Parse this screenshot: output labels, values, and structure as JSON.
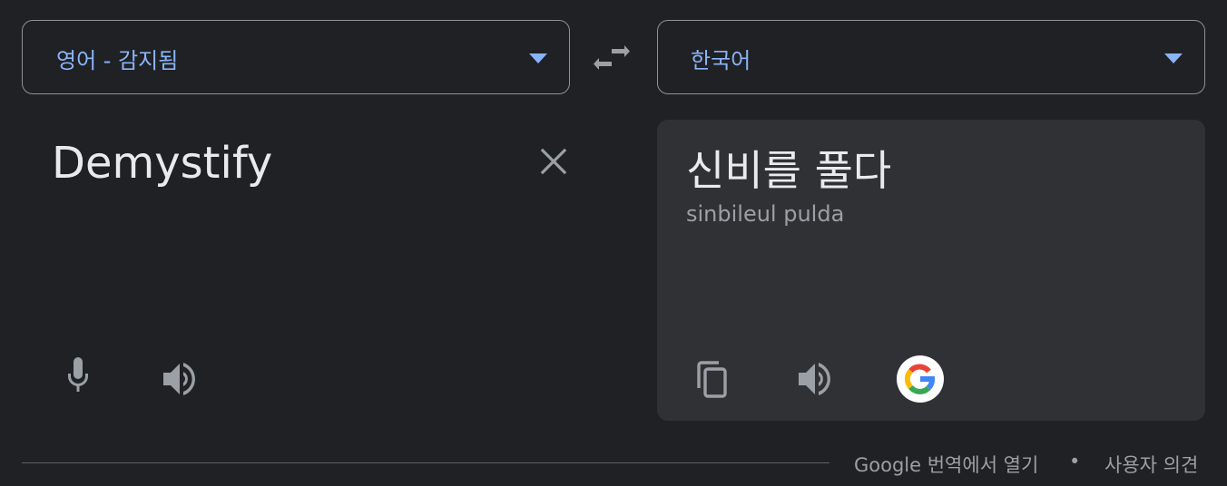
{
  "source_lang": {
    "label": "영어 - 감지됨",
    "icon": "dropdown-caret-icon"
  },
  "target_lang": {
    "label": "한국어",
    "icon": "dropdown-caret-icon"
  },
  "swap": {
    "icon": "swap-languages-icon"
  },
  "source": {
    "text": "Demystify",
    "clear_icon": "close-icon",
    "mic_icon": "microphone-icon",
    "listen_icon": "speaker-icon"
  },
  "result": {
    "text": "신비를 풀다",
    "transliteration": "sinbileul pulda",
    "copy_icon": "copy-icon",
    "listen_icon": "speaker-icon",
    "google_icon": "google-logo-icon"
  },
  "footer": {
    "open_in_translate": "Google 번역에서 열기",
    "separator": "•",
    "feedback": "사용자 의견"
  },
  "colors": {
    "background": "#202124",
    "panel": "#303134",
    "accent": "#8ab4f8",
    "text_primary": "#e8eaed",
    "text_secondary": "#9aa0a6",
    "border": "#8e9196"
  }
}
